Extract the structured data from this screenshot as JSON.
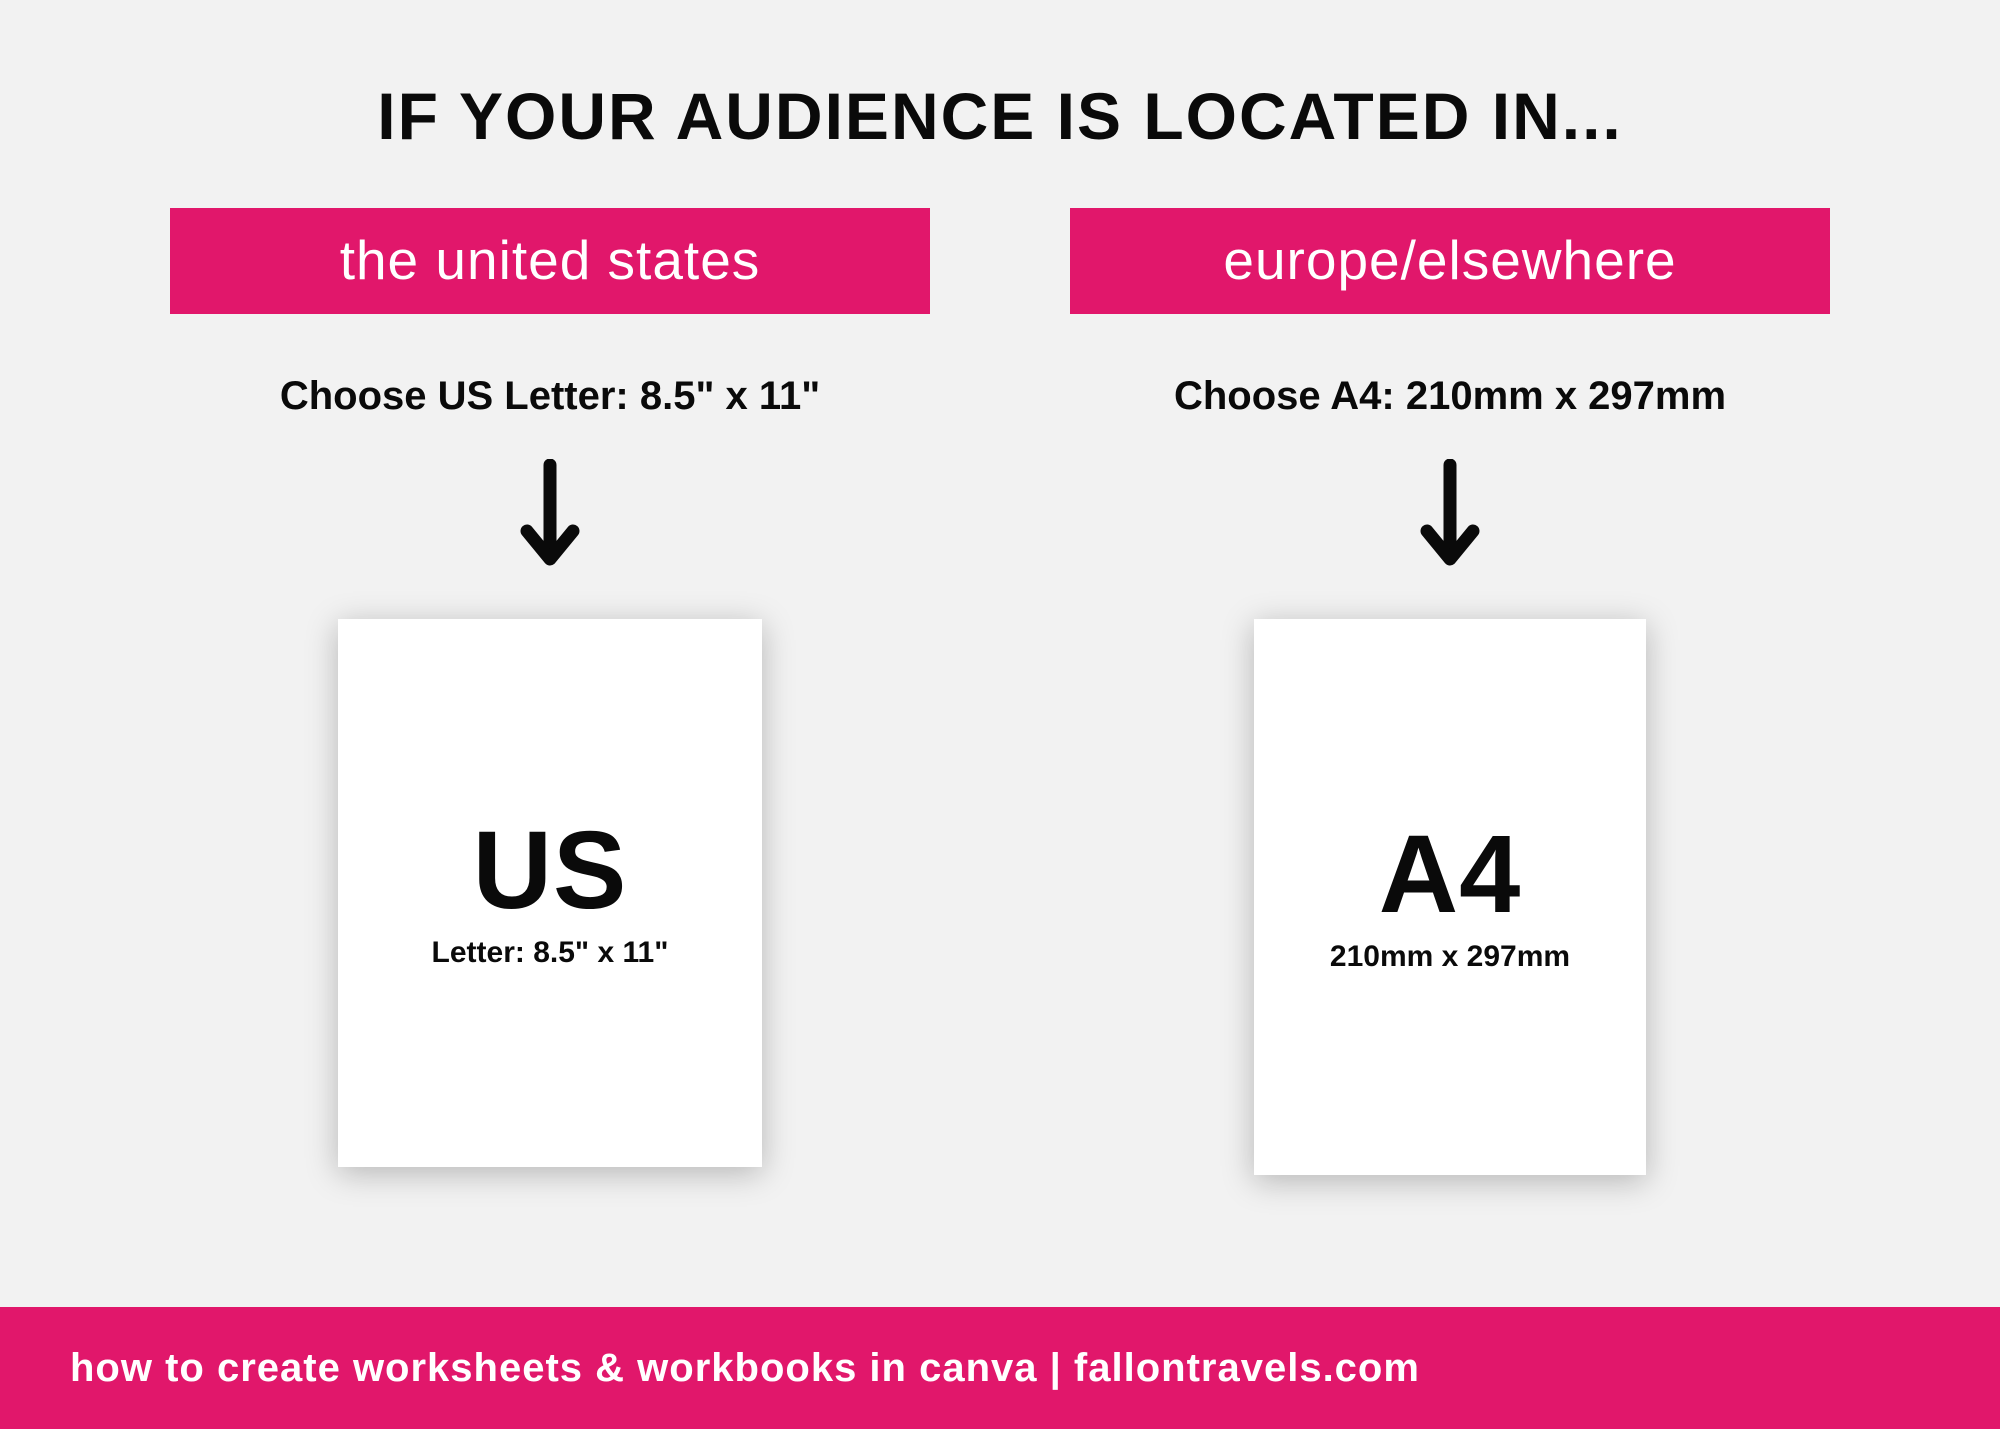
{
  "heading": "IF YOUR AUDIENCE IS LOCATED IN...",
  "columns": {
    "left": {
      "region": "the united states",
      "instruction": "Choose US Letter: 8.5\" x 11\"",
      "page_title": "US",
      "page_sub": "Letter: 8.5\" x 11\""
    },
    "right": {
      "region": "europe/elsewhere",
      "instruction": "Choose A4: 210mm x 297mm",
      "page_title": "A4",
      "page_sub": "210mm x 297mm"
    }
  },
  "footer": "how to create worksheets & workbooks in canva | fallontravels.com",
  "colors": {
    "accent": "#e1176b",
    "bg": "#f2f2f2",
    "text": "#0a0a0a"
  }
}
